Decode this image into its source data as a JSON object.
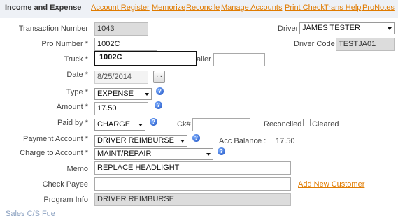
{
  "header": {
    "title": "Income and Expense",
    "links": [
      "Account Register",
      "Memorize",
      "Reconcile",
      "Manage Accounts",
      "Print Check",
      "Trans Help",
      "ProNotes"
    ]
  },
  "form": {
    "transaction_number_label": "Transaction Number",
    "transaction_number": "1043",
    "driver_label": "Driver",
    "driver_value": "JAMES TESTER",
    "pro_number_label": "Pro Number *",
    "pro_number": "1002C",
    "driver_code_label": "Driver Code",
    "driver_code": "TESTJA01",
    "truck_label": "Truck *",
    "truck_value": "1002C",
    "trailer_label_partial": "ailer",
    "date_label": "Date *",
    "date_value": "8/25/2014",
    "date_button": "...",
    "type_label": "Type *",
    "type_value": "EXPENSE",
    "amount_label": "Amount *",
    "amount_value": "17.50",
    "paid_by_label": "Paid by *",
    "paid_by_value": "CHARGE",
    "ck_label": "Ck#",
    "reconciled_label": "Reconciled",
    "cleared_label": "Cleared",
    "payment_account_label": "Payment Account *",
    "payment_account_value": "DRIVER REIMBURSE",
    "acc_balance_label": "Acc Balance :",
    "acc_balance_value": "17.50",
    "charge_account_label": "Charge to Account *",
    "charge_account_value": "MAINT/REPAIR",
    "memo_label": "Memo",
    "memo_value": "REPLACE HEADLIGHT",
    "check_payee_label": "Check Payee",
    "add_customer_link": "Add New Customer",
    "program_info_label": "Program Info",
    "program_info_value": "DRIVER REIMBURSE",
    "help_icon_text": "?"
  },
  "footer": {
    "partial_text": "Sales C/S Fue"
  }
}
